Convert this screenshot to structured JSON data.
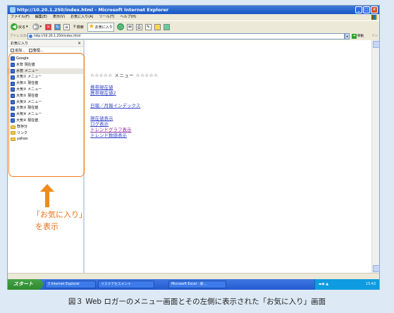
{
  "window": {
    "title": "http://10.20.1.250/index.html - Microsoft Internet Explorer"
  },
  "menubar": [
    "ファイル(F)",
    "編集(E)",
    "表示(V)",
    "お気に入り(A)",
    "ツール(T)",
    "ヘルプ(H)"
  ],
  "toolbar": {
    "back": "戻る",
    "search": "検索",
    "favorites": "お気に入り"
  },
  "address": {
    "label": "アドレス(D)",
    "url": "http://10.20.1.250/index.html",
    "go": "移動",
    "links": "リンク"
  },
  "favorites": {
    "title": "お気に入り",
    "close": "×",
    "add": "追加...",
    "organize": "整理...",
    "items": [
      {
        "label": "Google",
        "type": "page"
      },
      {
        "label": "水管 現在値",
        "type": "page"
      },
      {
        "label": "水管 メニュー",
        "type": "page"
      },
      {
        "label": "大気① メニュー",
        "type": "page"
      },
      {
        "label": "大気① 現在値",
        "type": "page"
      },
      {
        "label": "大気② メニュー",
        "type": "page"
      },
      {
        "label": "大気② 現在値",
        "type": "page"
      },
      {
        "label": "大気③ メニュー",
        "type": "page"
      },
      {
        "label": "大気③ 現在値",
        "type": "page"
      },
      {
        "label": "大気④ メニュー",
        "type": "page"
      },
      {
        "label": "大気④ 現在値",
        "type": "page"
      },
      {
        "label": "既存分",
        "type": "folder"
      },
      {
        "label": "リンク",
        "type": "folder"
      },
      {
        "label": "yahoo",
        "type": "folder"
      }
    ]
  },
  "content": {
    "menu_title": "☆☆☆☆☆ メニュー ☆☆☆☆☆",
    "links": [
      "携帯現在値",
      "携帯現在値2",
      "日報／月報インデックス",
      "現在値表示",
      "ログ表示",
      "トレンドグラフ表示",
      "トレンド数値表示"
    ]
  },
  "taskbar": {
    "start": "スタート",
    "buttons": [
      "3 Internet Explorer",
      "リスクアセスメント",
      "Microsoft Excel - 新..."
    ],
    "clock": "15:43"
  },
  "annotation": {
    "line1": "「お気に入り」",
    "line2": "を表示"
  },
  "caption": "図３ Web ロガーのメニュー画面とその左側に表示された「お気に入り」画面"
}
